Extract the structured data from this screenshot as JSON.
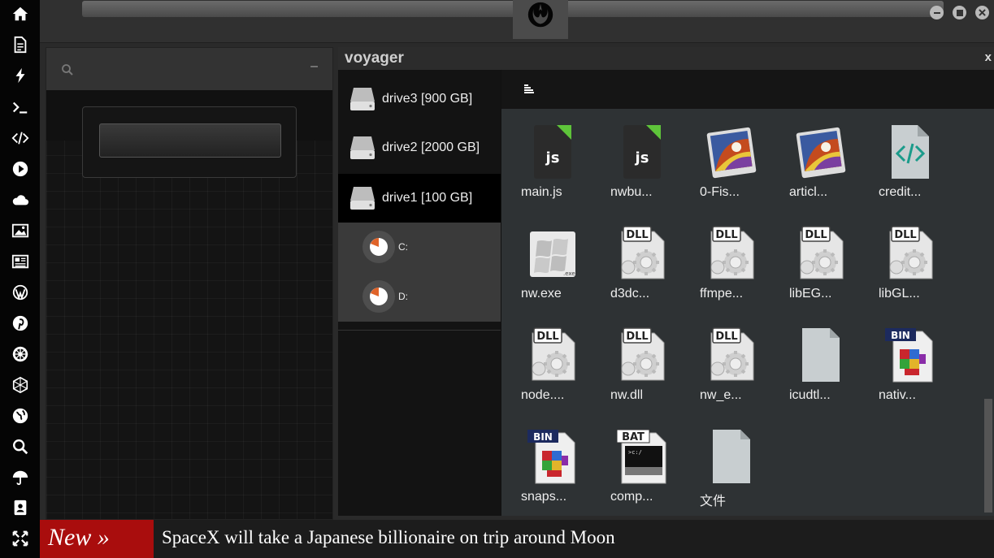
{
  "sidebar": {
    "icons": [
      "home-icon",
      "document-icon",
      "bolt-icon",
      "terminal-icon",
      "code-icon",
      "play-icon",
      "cloud-icon",
      "image-icon",
      "news-icon",
      "wordpress-icon",
      "pinterest-icon",
      "empire-icon",
      "hexagon-icon",
      "globe-icon",
      "search-icon",
      "umbrella-icon",
      "contacts-icon",
      "expand-icon"
    ]
  },
  "voyager": {
    "title": "voyager",
    "close_label": "x",
    "drives": [
      {
        "label": "drive3 [900 GB]"
      },
      {
        "label": "drive2 [2000 GB]"
      },
      {
        "label": "drive1 [100 GB]"
      }
    ],
    "partitions": [
      {
        "label": "C:"
      },
      {
        "label": "D:"
      }
    ],
    "files": [
      {
        "name": "main.js",
        "type": "js"
      },
      {
        "name": "nwbu...",
        "type": "js"
      },
      {
        "name": "0-Fis...",
        "type": "image"
      },
      {
        "name": "articl...",
        "type": "image"
      },
      {
        "name": "credit...",
        "type": "code"
      },
      {
        "name": "nw.exe",
        "type": "exe"
      },
      {
        "name": "d3dc...",
        "type": "dll"
      },
      {
        "name": "ffmpe...",
        "type": "dll"
      },
      {
        "name": "libEG...",
        "type": "dll"
      },
      {
        "name": "libGL...",
        "type": "dll"
      },
      {
        "name": "node....",
        "type": "dll"
      },
      {
        "name": "nw.dll",
        "type": "dll"
      },
      {
        "name": "nw_e...",
        "type": "dll"
      },
      {
        "name": "icudtl...",
        "type": "blank"
      },
      {
        "name": "nativ...",
        "type": "bin"
      },
      {
        "name": "snaps...",
        "type": "bin"
      },
      {
        "name": "comp...",
        "type": "bat"
      },
      {
        "name": "文件",
        "type": "blank"
      }
    ]
  },
  "ticker": {
    "badge": "New »",
    "headline": "SpaceX will take a Japanese billionaire on trip around Moon"
  },
  "colors": {
    "badge_red": "#a90d0d",
    "js_green": "#5ec43a",
    "code_teal": "#1a9b8a"
  }
}
